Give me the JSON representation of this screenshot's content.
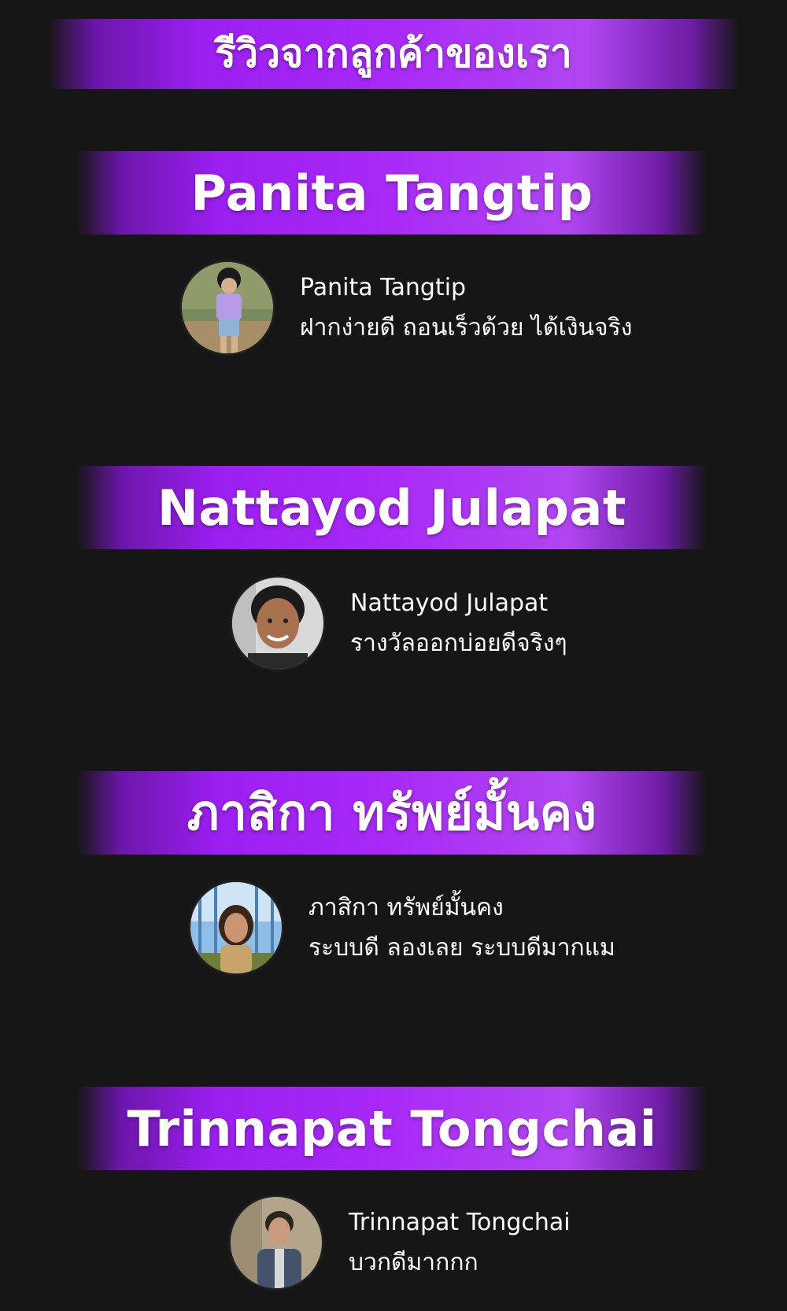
{
  "page_title": "รีวิวจากลูกค้าของเรา",
  "reviews": [
    {
      "heading": "Panita Tangtip",
      "name": "Panita Tangtip",
      "comment": "ฝากง่ายดี ถอนเร็วด้วย ได้เงินจริง"
    },
    {
      "heading": "Nattayod Julapat",
      "name": "Nattayod Julapat",
      "comment": "รางวัลออกบ่อยดีจริงๆ"
    },
    {
      "heading": "ภาสิกา ทรัพย์มั้นคง",
      "name": "ภาสิกา ทรัพย์มั้นคง",
      "comment": "ระบบดี ลองเลย ระบบดีมากแม"
    },
    {
      "heading": "Trinnapat Tongchai",
      "name": "Trinnapat Tongchai",
      "comment": "บวกดีมากกก"
    }
  ],
  "colors": {
    "background": "#161616",
    "banner_purple": "#a92af7",
    "text": "#ffffff"
  }
}
